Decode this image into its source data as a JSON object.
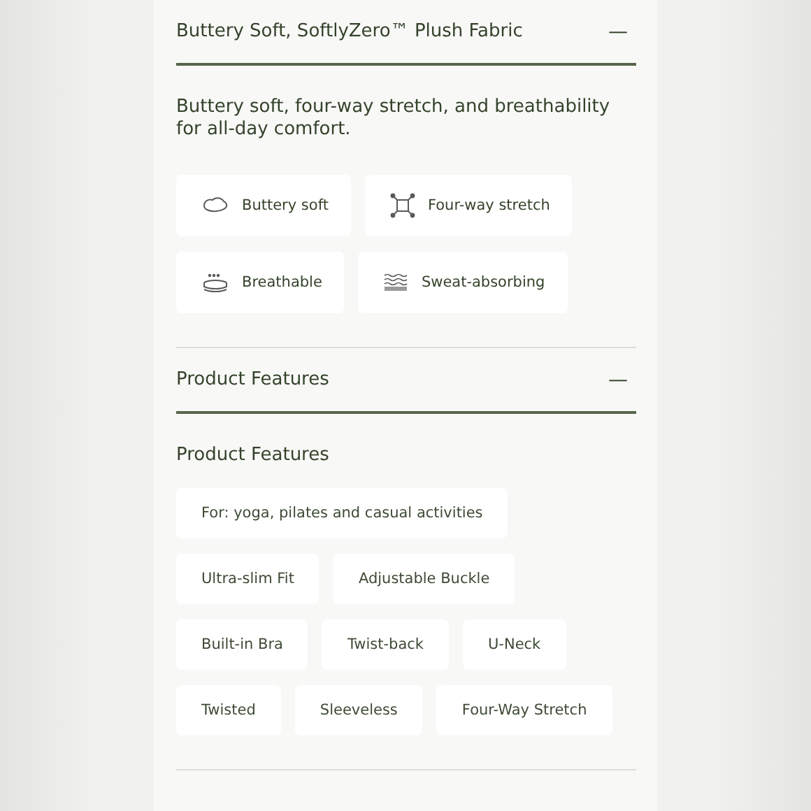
{
  "sections": [
    {
      "title": "Buttery Soft, SoftlyZero™ Plush Fabric",
      "expanded": true,
      "toggle": "—",
      "description": "Buttery soft, four-way stretch, and breathability for all-day comfort.",
      "benefits": [
        {
          "label": "Buttery soft",
          "kind": "soft"
        },
        {
          "label": "Four-way stretch",
          "kind": "stretch"
        },
        {
          "label": "Breathable",
          "kind": "breathable"
        },
        {
          "label": "Sweat-absorbing",
          "kind": "sweat"
        }
      ]
    },
    {
      "title": "Product Features",
      "expanded": true,
      "toggle": "—",
      "subtitle": "Product Features",
      "tags": [
        [
          "For: yoga, pilates and casual activities"
        ],
        [
          "Ultra-slim Fit",
          "Adjustable Buckle"
        ],
        [
          "Built-in Bra",
          "Twist-back",
          "U-Neck"
        ],
        [
          "Twisted",
          "Sleeveless",
          "Four-Way Stretch"
        ]
      ]
    }
  ]
}
